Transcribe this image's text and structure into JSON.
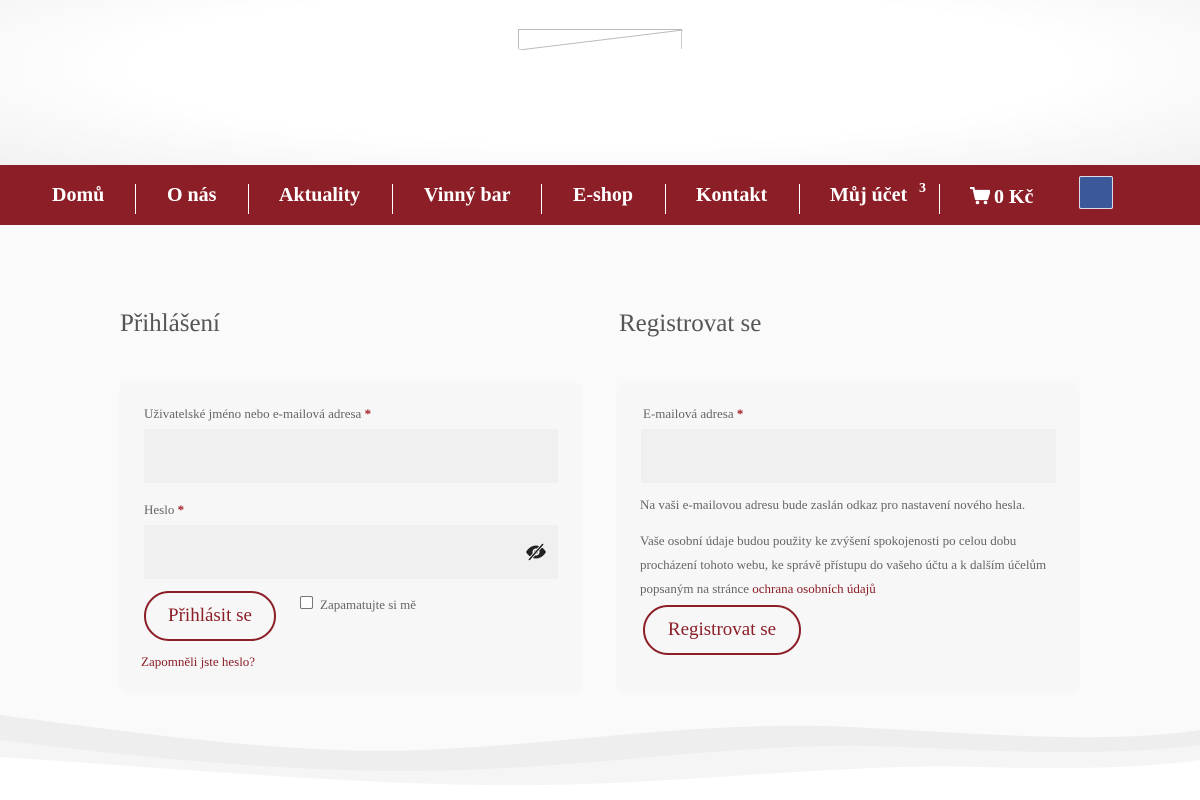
{
  "nav": {
    "items": [
      {
        "label": "Domů"
      },
      {
        "label": "O nás"
      },
      {
        "label": "Aktuality"
      },
      {
        "label": "Vinný bar"
      },
      {
        "label": "E-shop"
      },
      {
        "label": "Kontakt"
      },
      {
        "label": "Můj účet"
      }
    ],
    "account_badge": "3",
    "cart_total": "0 Kč",
    "facebook_glyph": "",
    "colors": {
      "bar": "#8b1e26",
      "facebook": "#3b5998"
    }
  },
  "login": {
    "title": "Přihlášení",
    "username_label": "Uživatelské jméno nebo e-mailová adresa",
    "password_label": "Heslo",
    "required_mark": "*",
    "submit_label": "Přihlásit se",
    "remember_label": "Zapamatujte si mě",
    "forgot_link": "Zapomněli jste heslo?"
  },
  "register": {
    "title": "Registrovat se",
    "email_label": "E-mailová adresa",
    "required_mark": "*",
    "info_text": "Na vaši e-mailovou adresu bude zaslán odkaz pro nastavení nového hesla.",
    "privacy_text": "Vaše osobní údaje budou použity ke zvýšení spokojenosti po celou dobu procházení tohoto webu, ke správě přístupu do vašeho účtu a k dalším účelům popsaným na stránce ",
    "privacy_link": "ochrana osobních údajů",
    "submit_label": "Registrovat se"
  },
  "icons": {
    "cart": "cart-icon",
    "eye": "eye-slash-icon",
    "facebook": "facebook-icon"
  }
}
